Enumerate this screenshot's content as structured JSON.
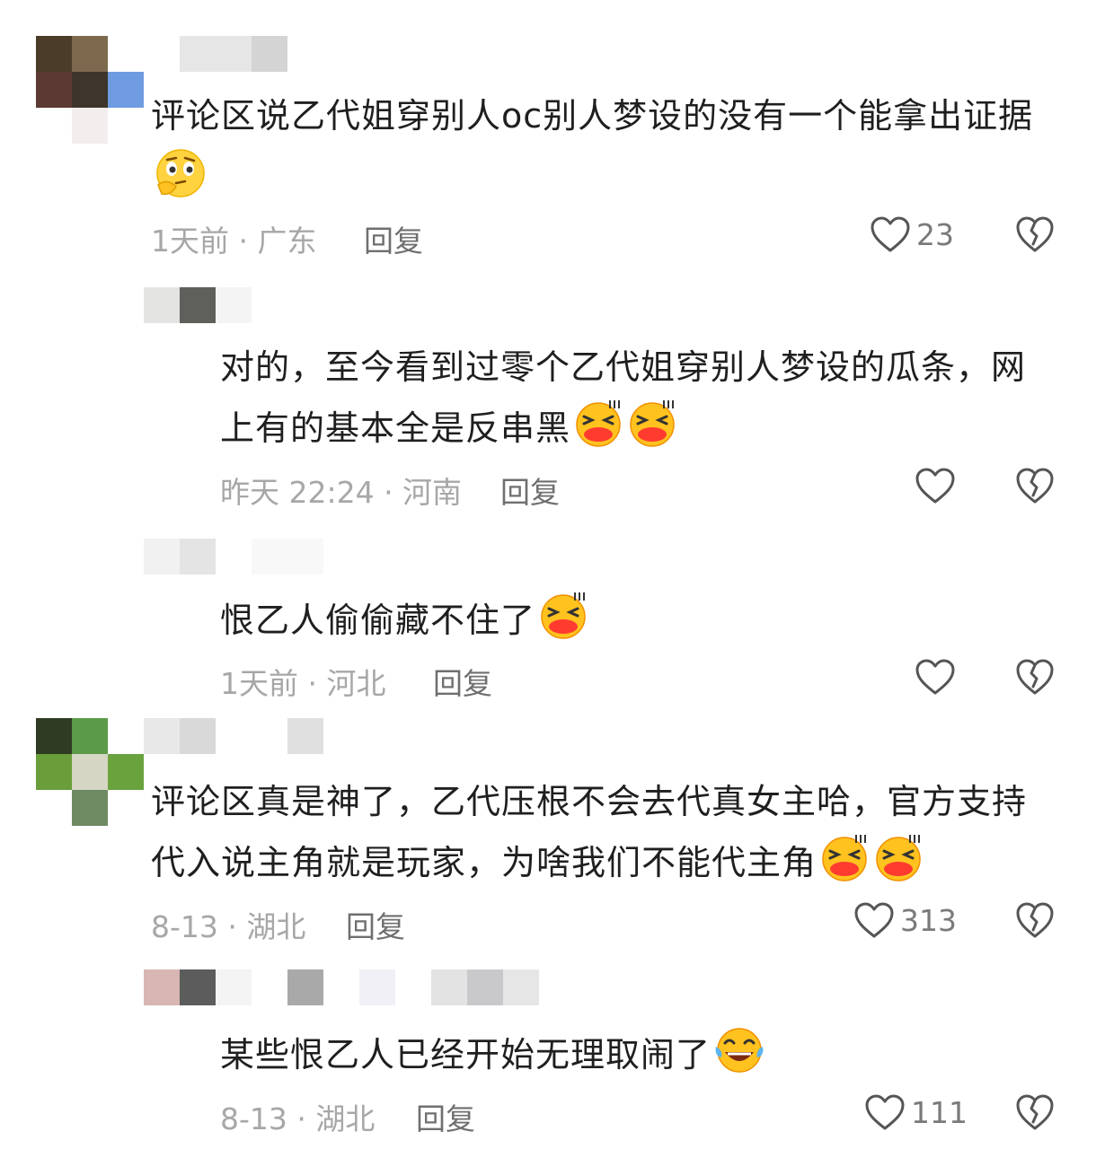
{
  "comments": [
    {
      "text": "评论区说乙代姐穿别人oc别人梦设的没有一个能拿出证据",
      "emojis": [
        "thinking-face"
      ],
      "time": "1天前",
      "location": "广东",
      "meta": "1天前 · 广东",
      "reply_label": "回复",
      "likes": "23"
    },
    {
      "text": "对的，至今看到过零个乙代姐穿别人梦设的瓜条，网上有的基本全是反串黑",
      "emojis": [
        "grinning-squint-face",
        "grinning-squint-face"
      ],
      "meta": "昨天 22:24 · 河南",
      "reply_label": "回复",
      "likes": ""
    },
    {
      "text": "恨乙人偷偷藏不住了",
      "emojis": [
        "grinning-squint-face"
      ],
      "meta": "1天前 · 河北",
      "reply_label": "回复",
      "likes": ""
    },
    {
      "text": "评论区真是神了，乙代压根不会去代真女主哈，官方支持代入说主角就是玩家，为啥我们不能代主角",
      "emojis": [
        "grinning-squint-face",
        "grinning-squint-face"
      ],
      "meta": "8-13 · 湖北",
      "reply_label": "回复",
      "likes": "313"
    },
    {
      "text": "某些恨乙人已经开始无理取闹了",
      "emojis": [
        "laughing-tears-face"
      ],
      "meta": "8-13 · 湖北",
      "reply_label": "回复",
      "likes": "111"
    }
  ],
  "icons": {
    "like": "heart-outline-icon",
    "dislike": "broken-heart-icon"
  },
  "colors": {
    "text": "#1f1f1f",
    "meta": "#a7a7a7",
    "reply": "#6f6f6f",
    "icon": "#555555"
  }
}
